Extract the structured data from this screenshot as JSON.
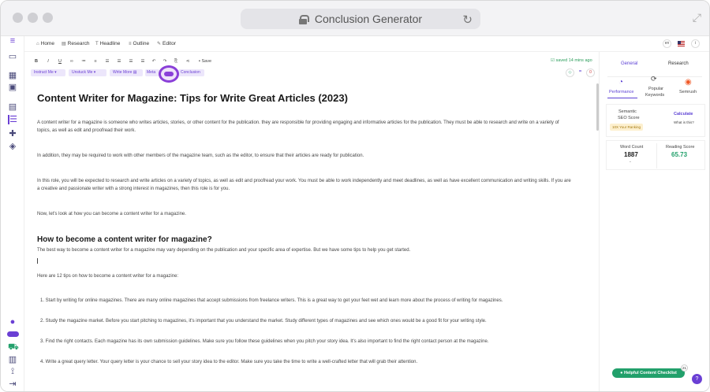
{
  "window": {
    "title": "Conclusion Generator"
  },
  "nav": {
    "home": "Home",
    "research": "Research",
    "headline": "Headline",
    "outline": "Outline",
    "editor": "Editor"
  },
  "lang": {
    "code": "en"
  },
  "toolbar": {
    "bold": "B",
    "italic": "I",
    "underline": "U",
    "save": "Save",
    "saved_status": "saved 14 mins ago",
    "counter": "0",
    "instruct_me": "Instruct Me",
    "unstuck_me": "Unstuck Me",
    "write_more": "Write More",
    "meta": "Meta",
    "conclusion": "Conclusion"
  },
  "doc": {
    "title": "Content Writer for Magazine: Tips for Write Great Articles (2023)",
    "p1": "A content writer for a magazine is someone who writes articles, stories, or other content for the publication. they are responsible for providing engaging and informative articles for the publication. They must be able to research and write on a variety of topics, as well as edit and proofread their work.",
    "p2": "In addition, they may be required to work with other members of the magazine team, such as the editor, to ensure that their articles are ready for publication.",
    "p3": "In this role, you will be expected to research and write articles on a variety of topics, as well as edit and proofread your work. You must be able to work independently and meet deadlines, as well as have excellent communication and writing skills. If you are a creative and passionate writer with a strong interest in magazines, then this role is for you.",
    "p4": "Now, let's look at how you can become a content writer for a magazine.",
    "h2": "How to become a content writer for magazine?",
    "p5": "The best way to become a content writer for a magazine may vary depending on the publication and your specific area of expertise. But we have some tips to help you get started.",
    "p6": "Here are 12 tips on how to become a content writer for a magazine:",
    "li1": "1. Start by writing for online magazines. There are many online magazines that accept submissions from freelance writers. This is a great way to get your feet wet and learn more about the process of writing for magazines.",
    "li2": "2. Study the magazine market. Before you start pitching to magazines, it's important that you understand the market. Study different types of magazines and see which ones would be a good fit for your writing style.",
    "li3": "3. Find the right contacts. Each magazine has its own submission guidelines. Make sure you follow these guidelines when you pitch your story idea. It's also important to find the right contact person at the magazine.",
    "li4": "4. Write a great query letter. Your query letter is your chance to sell your story idea to the editor. Make sure you take the time to write a well-crafted letter that will grab their attention."
  },
  "panel": {
    "tab_general": "General",
    "tab_research": "Research",
    "performance": "Performance",
    "popular": "Popular",
    "keywords": "Keywords",
    "semrush": "Semrush",
    "semantic": "Semantic",
    "seo_score": "SEO Score",
    "ranking_badge": "10X Your Ranking",
    "calculate": "Calculate",
    "what_is_this": "What is this?",
    "word_count_label": "Word Count",
    "word_count": "1887",
    "word_count_sub": "-",
    "reading_label": "Reading Score",
    "reading_score": "65.73",
    "checklist": "Helpful Content Checklist",
    "checklist_count": "21",
    "help": "?"
  },
  "colors": {
    "accent": "#6a3fd4",
    "green": "#22a06b",
    "highlight": "#8a3fd8"
  }
}
